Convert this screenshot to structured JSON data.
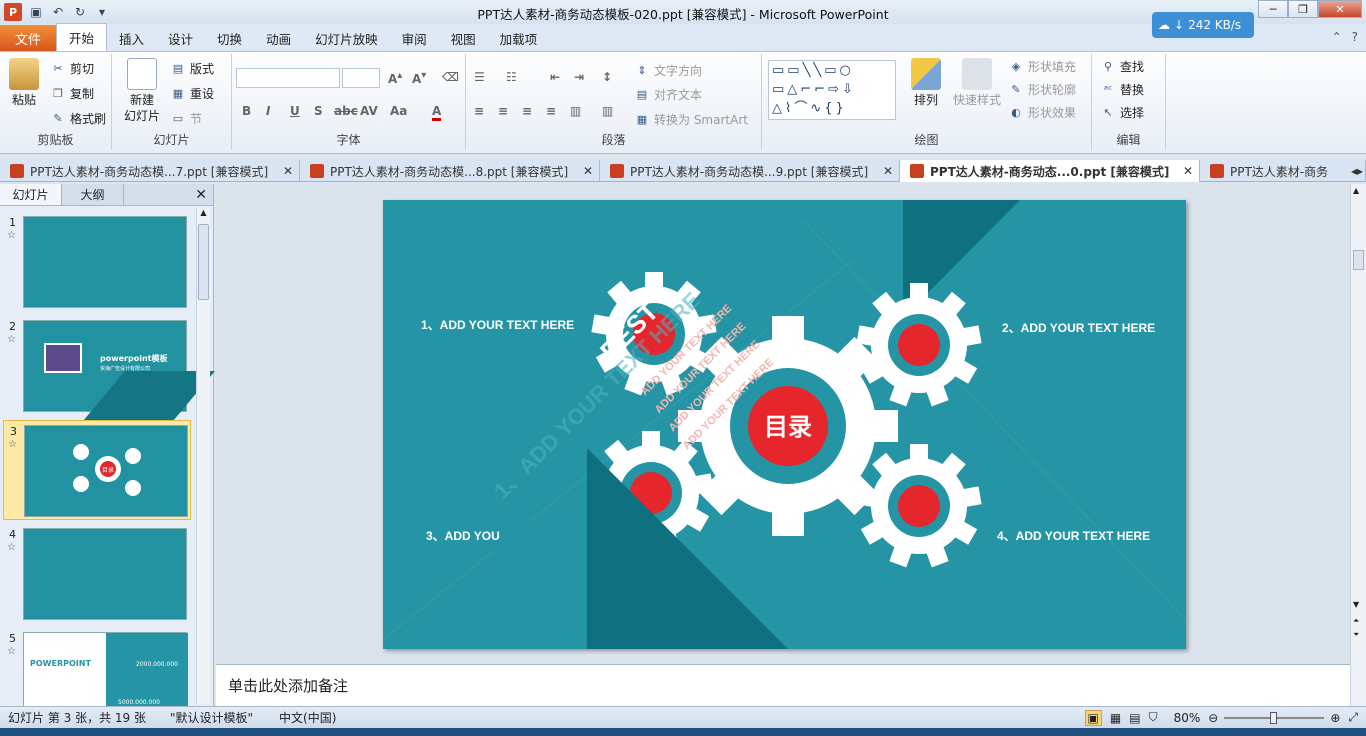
{
  "window": {
    "title": "PPT达人素材-商务动态模板-020.ppt [兼容模式]  -  Microsoft PowerPoint",
    "app_icon": "P",
    "net_speed": "242 KB/s"
  },
  "ribbon_tabs": [
    "开始",
    "插入",
    "设计",
    "切换",
    "动画",
    "幻灯片放映",
    "审阅",
    "视图",
    "加载项"
  ],
  "file_tab": "文件",
  "active_tab": "开始",
  "clipboard": {
    "paste": "粘贴",
    "cut": "剪切",
    "copy": "复制",
    "format_painter": "格式刷",
    "label": "剪贴板"
  },
  "slides_group": {
    "new_slide_line1": "新建",
    "new_slide_line2": "幻灯片",
    "layout": "版式",
    "reset": "重设",
    "section": "节",
    "label": "幻灯片"
  },
  "font_group": {
    "label": "字体",
    "bold": "B",
    "italic": "I",
    "underline": "U",
    "shadow": "S",
    "strike": "abc",
    "spacing": "AV",
    "case": "Aa",
    "color": "A"
  },
  "paragraph_group": {
    "text_direction": "文字方向",
    "align_text": "对齐文本",
    "smartart": "转换为 SmartArt",
    "label": "段落"
  },
  "drawing_group": {
    "arrange": "排列",
    "quick_styles": "快速样式",
    "shape_fill": "形状填充",
    "shape_outline": "形状轮廓",
    "shape_effects": "形状效果",
    "label": "绘图"
  },
  "editing_group": {
    "find": "查找",
    "replace": "替换",
    "select": "选择",
    "label": "编辑"
  },
  "doc_tabs": [
    {
      "title": "PPT达人素材-商务动态模...7.ppt [兼容模式]",
      "active": false
    },
    {
      "title": "PPT达人素材-商务动态模...8.ppt [兼容模式]",
      "active": false
    },
    {
      "title": "PPT达人素材-商务动态模...9.ppt [兼容模式]",
      "active": false
    },
    {
      "title": "PPT达人素材-商务动态...0.ppt [兼容模式]",
      "active": true
    },
    {
      "title": "PPT达人素材-商务",
      "active": false
    }
  ],
  "panel": {
    "tab_slides": "幻灯片",
    "tab_outline": "大纲"
  },
  "thumbnails": [
    {
      "num": "1"
    },
    {
      "num": "2",
      "brand": "powerpoint模板",
      "sub": "资海广告设计有限公司"
    },
    {
      "num": "3",
      "center": "目录"
    },
    {
      "num": "4"
    },
    {
      "num": "5",
      "heading": "POWERPOINT",
      "stat1": "2000.000.000",
      "stat2": "5000.000.000"
    }
  ],
  "slide": {
    "center_label": "目录",
    "item1": "1、ADD YOUR TEXT HERE",
    "item2": "2、ADD YOUR TEXT HERE",
    "item3": "3、ADD YOU",
    "item4": "4、ADD YOUR TEXT HERE",
    "diag_big": "REST",
    "diag_lines": [
      "ADD YOUR TEXT HERE",
      "ADD YOUR TEXT HERE",
      "ADD YOUR TEXT HERE",
      "ADD YOUR TEXT HERE"
    ],
    "watermark": "1、ADD YOUR TEXT HERE",
    "colors": {
      "bg": "#2595a5",
      "dark": "#0f7180",
      "red": "#e5262c",
      "gear": "#ffffff"
    }
  },
  "notes_placeholder": "单击此处添加备注",
  "status": {
    "slide_info": "幻灯片 第 3 张，共 19 张",
    "theme": "\"默认设计模板\"",
    "language": "中文(中国)",
    "zoom": "80%"
  }
}
